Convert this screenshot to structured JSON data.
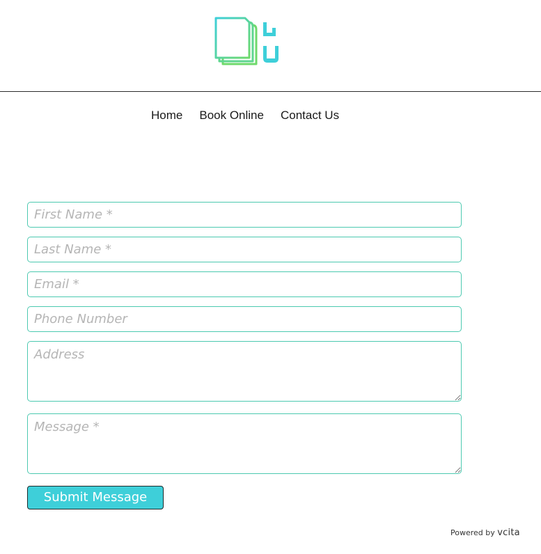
{
  "header": {
    "logo": {
      "icon": "book-stack-logo-icon",
      "colors": [
        "#3ecfd9",
        "#6fd96b"
      ]
    }
  },
  "nav": {
    "items": [
      {
        "label": "Home"
      },
      {
        "label": "Book Online"
      },
      {
        "label": "Contact Us"
      }
    ]
  },
  "form": {
    "first_name_placeholder": "First Name *",
    "last_name_placeholder": "Last Name *",
    "email_placeholder": "Email *",
    "phone_placeholder": "Phone Number",
    "address_placeholder": "Address",
    "message_placeholder": "Message *",
    "submit_label": "Submit Message",
    "border_color": "#4cc9b0",
    "button_color": "#3ecfd9"
  },
  "footer": {
    "powered_by": "Powered by",
    "brand": "vcita"
  }
}
